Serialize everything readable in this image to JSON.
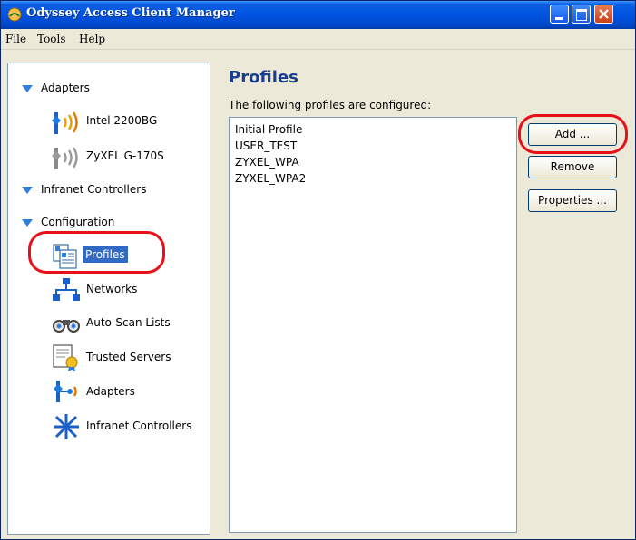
{
  "window": {
    "title": "Odyssey Access Client Manager"
  },
  "menu": {
    "file": "File",
    "tools": "Tools",
    "help": "Help"
  },
  "tree": {
    "adapters": "Adapters",
    "adapter1": "Intel 2200BG",
    "adapter2": "ZyXEL G-170S",
    "infranet": "Infranet Controllers",
    "configuration": "Configuration",
    "profiles": "Profiles",
    "networks": "Networks",
    "autoscan": "Auto-Scan Lists",
    "trusted": "Trusted Servers",
    "cfg_adapters": "Adapters",
    "cfg_infranet": "Infranet Controllers"
  },
  "main": {
    "heading": "Profiles",
    "subtext": "The following profiles are configured:",
    "profiles": [
      "Initial Profile",
      "USER_TEST",
      "ZYXEL_WPA",
      "ZYXEL_WPA2"
    ]
  },
  "buttons": {
    "add": "Add ...",
    "remove": "Remove",
    "properties": "Properties ..."
  },
  "colors": {
    "titlebar": "#0054e3",
    "highlight_circle": "#e8101a",
    "heading": "#1a3e8f"
  }
}
